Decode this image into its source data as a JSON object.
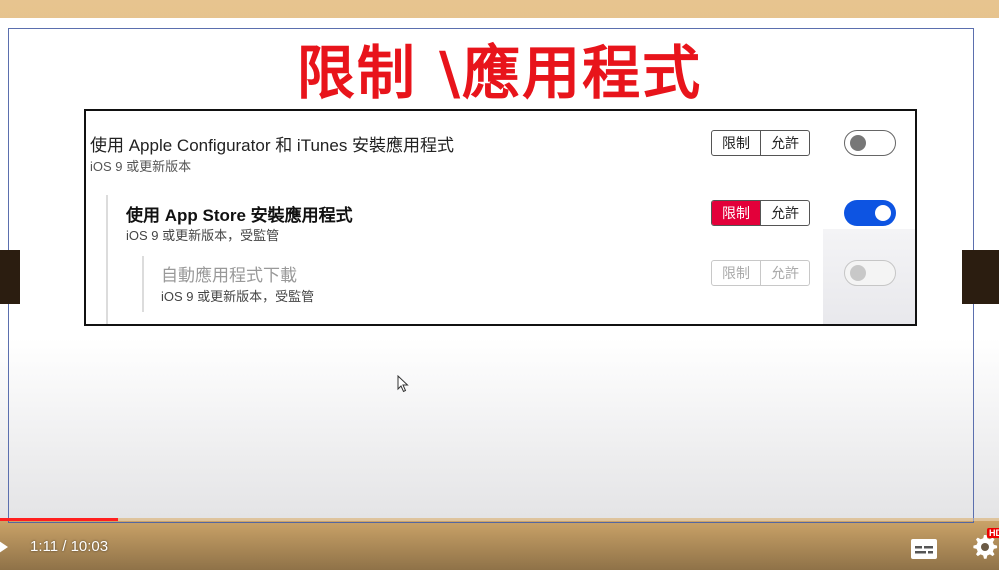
{
  "slide": {
    "title": "限制 \\應用程式"
  },
  "panel": {
    "rows": [
      {
        "label": "使用 Apple Configurator 和 iTunes 安裝應用程式",
        "sub": "iOS 9 或更新版本",
        "restrict": "限制",
        "allow": "允許",
        "selected": "none",
        "toggle_on": false
      },
      {
        "label": "使用 App Store 安裝應用程式",
        "sub": "iOS 9 或更新版本，受監管",
        "restrict": "限制",
        "allow": "允許",
        "selected": "restrict",
        "toggle_on": true
      },
      {
        "label": "自動應用程式下載",
        "sub": "iOS 9 或更新版本，受監管",
        "restrict": "限制",
        "allow": "允許",
        "selected": "none",
        "toggle_on": false,
        "disabled": true
      }
    ]
  },
  "player": {
    "time": "1:11 / 10:03",
    "progress_fraction": 0.118,
    "buffer_fraction": 0.06,
    "badge": "HD"
  },
  "colors": {
    "title": "#e8141b",
    "restrict_active": "#e3003a",
    "toggle_on": "#0d54e2",
    "progress": "#ff1f1f"
  },
  "icons": [
    "cursor-icon",
    "play-icon",
    "subtitles-icon",
    "gear-icon"
  ]
}
